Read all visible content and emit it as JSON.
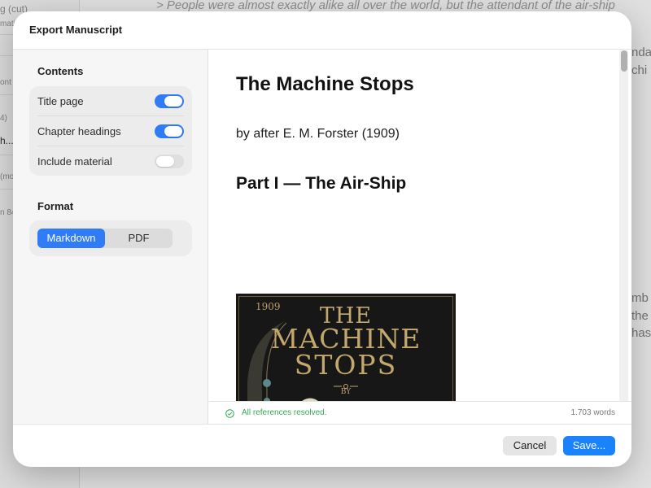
{
  "background": {
    "sidebar_items": [
      "g (cut)",
      "mati",
      "ont",
      "4)",
      "h...",
      "(mo",
      "n 84"
    ],
    "editor_quote": "> People were almost exactly alike all over the world, but the attendant of the air-ship",
    "right_fragments": [
      "nda",
      "chi",
      "mb",
      "the",
      "has"
    ]
  },
  "dialog": {
    "title": "Export Manuscript",
    "contents_section": {
      "title": "Contents",
      "options": [
        {
          "label": "Title page",
          "enabled": true
        },
        {
          "label": "Chapter headings",
          "enabled": true
        },
        {
          "label": "Include material",
          "enabled": false
        }
      ]
    },
    "format_section": {
      "title": "Format",
      "options": [
        "Markdown",
        "PDF"
      ],
      "selected": "Markdown"
    },
    "preview": {
      "title": "The Machine Stops",
      "byline": "by after E. M. Forster (1909)",
      "part_heading": "Part I — The Air-Ship",
      "cover": {
        "year": "1909",
        "line1": "THE",
        "line2": "MACHINE",
        "line3": "STOPS",
        "by": "BY"
      }
    },
    "status": {
      "message": "All references resolved.",
      "word_count": "1.703 words"
    },
    "buttons": {
      "cancel": "Cancel",
      "save": "Save..."
    },
    "colors": {
      "accent": "#2f7cf6",
      "save_button": "#1a82fb",
      "success": "#34a853"
    }
  }
}
